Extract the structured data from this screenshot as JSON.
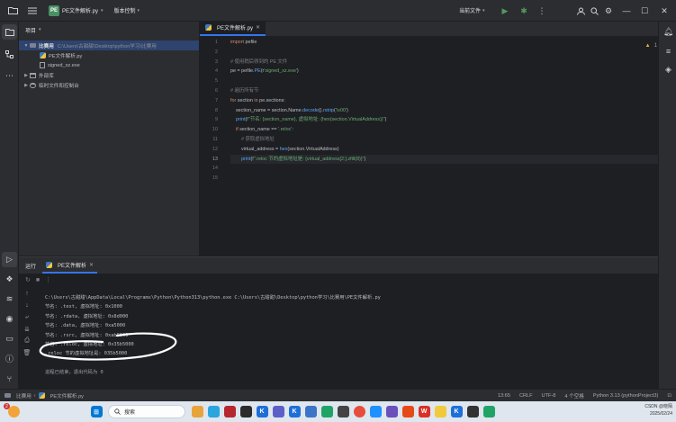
{
  "titlebar": {
    "project_badge": "PE",
    "project_name": "PE文件解析.py",
    "vcs_label": "版本控制",
    "run_config": "当前文件"
  },
  "project_panel": {
    "title": "项目",
    "tree": [
      {
        "label": "比赛用",
        "path": "C:\\Users\\古甜甜\\Desktop\\python学习\\比赛用",
        "type": "folder",
        "selected": true,
        "indent": 1,
        "expanded": true
      },
      {
        "label": "PE文件解析.py",
        "type": "py",
        "indent": 2
      },
      {
        "label": "signed_xz.exe",
        "type": "exe",
        "indent": 2
      },
      {
        "label": "外部库",
        "type": "lib",
        "indent": 1
      },
      {
        "label": "临时文件和控制台",
        "type": "scratch",
        "indent": 1
      }
    ]
  },
  "editor": {
    "tab_label": "PE文件解析.py",
    "inspection_count": "1",
    "current_line": 13,
    "lines": [
      [
        {
          "t": "import",
          "c": "kw"
        },
        {
          "t": " pefile",
          "c": "param"
        }
      ],
      [],
      [
        {
          "t": "# 使用稍后得到的 PE 文件",
          "c": "cm"
        }
      ],
      [
        {
          "t": "pe = pefile.",
          "c": "param"
        },
        {
          "t": "PE",
          "c": "fn"
        },
        {
          "t": "(r",
          "c": "param"
        },
        {
          "t": "'signed_xz.exe'",
          "c": "str"
        },
        {
          "t": ")",
          "c": "param"
        }
      ],
      [],
      [
        {
          "t": "# 遍历所有节",
          "c": "cm"
        }
      ],
      [
        {
          "t": "for",
          "c": "kw"
        },
        {
          "t": " section ",
          "c": "param"
        },
        {
          "t": "in",
          "c": "kw"
        },
        {
          "t": " pe.sections:",
          "c": "param"
        }
      ],
      [
        {
          "t": "    section_name = section.Name.",
          "c": "param"
        },
        {
          "t": "decode",
          "c": "fn"
        },
        {
          "t": "().",
          "c": "param"
        },
        {
          "t": "rstrip",
          "c": "fn"
        },
        {
          "t": "(",
          "c": "param"
        },
        {
          "t": "'\\x00'",
          "c": "str"
        },
        {
          "t": ")",
          "c": "param"
        }
      ],
      [
        {
          "t": "    ",
          "c": "param"
        },
        {
          "t": "print",
          "c": "fn"
        },
        {
          "t": "(",
          "c": "param"
        },
        {
          "t": "f\"节名: {section_name}, 虚拟地址: {hex(section.VirtualAddress)}\"",
          "c": "str"
        },
        {
          "t": ")",
          "c": "param"
        }
      ],
      [
        {
          "t": "    ",
          "c": "param"
        },
        {
          "t": "if",
          "c": "kw"
        },
        {
          "t": " section_name == ",
          "c": "param"
        },
        {
          "t": "'.reloc'",
          "c": "str"
        },
        {
          "t": ":",
          "c": "param"
        }
      ],
      [
        {
          "t": "        # 获取虚拟地址",
          "c": "cm"
        }
      ],
      [
        {
          "t": "        virtual_address = ",
          "c": "param"
        },
        {
          "t": "hex",
          "c": "fn"
        },
        {
          "t": "(section.VirtualAddress)",
          "c": "param"
        }
      ],
      [
        {
          "t": "        ",
          "c": "param"
        },
        {
          "t": "print",
          "c": "fn"
        },
        {
          "t": "(",
          "c": "param"
        },
        {
          "t": "f\".reloc 节的虚拟地址是: {virtual_address[2:].zfill(8)}\"",
          "c": "str"
        },
        {
          "t": ")",
          "c": "param"
        }
      ],
      [],
      []
    ]
  },
  "run_panel": {
    "title": "运行",
    "tab_label": "PE文件解析",
    "output": [
      {
        "text": "C:\\Users\\古甜甜\\AppData\\Local\\Programs\\Python\\Python313\\python.exe C:\\Users\\古甜甜\\Desktop\\python学习\\比赛用\\PE文件解析.py",
        "dim": false
      },
      {
        "text": "节名: .text, 虚拟地址: 0x1000",
        "dim": false
      },
      {
        "text": "节名: .rdata, 虚拟地址: 0x8d000",
        "dim": false
      },
      {
        "text": "节名: .data, 虚拟地址: 0xa5000",
        "dim": false
      },
      {
        "text": "节名: .rsrc, 虚拟地址: 0xab6000",
        "dim": false
      },
      {
        "text": "节名: .reloc, 虚拟地址: 0x35b5000",
        "dim": false
      },
      {
        "text": ".reloc 节的虚拟地址是: 035b5000",
        "dim": false
      },
      {
        "text": "",
        "dim": false
      },
      {
        "text": "进程已结束，退出代码为 0",
        "dim": true
      }
    ]
  },
  "statusbar": {
    "breadcrumb_root": "比赛用",
    "breadcrumb_file": "PE文件解析.py",
    "cursor": "13:65",
    "line_sep": "CRLF",
    "encoding": "UTF-8",
    "indent": "4 个空格",
    "interpreter": "Python 3.13 (pythonProject3)"
  },
  "taskbar": {
    "search_placeholder": "搜索",
    "weather_badge": "2",
    "tray_line1": "CSDN @晓陌",
    "tray_line2": "2025/02/24"
  }
}
